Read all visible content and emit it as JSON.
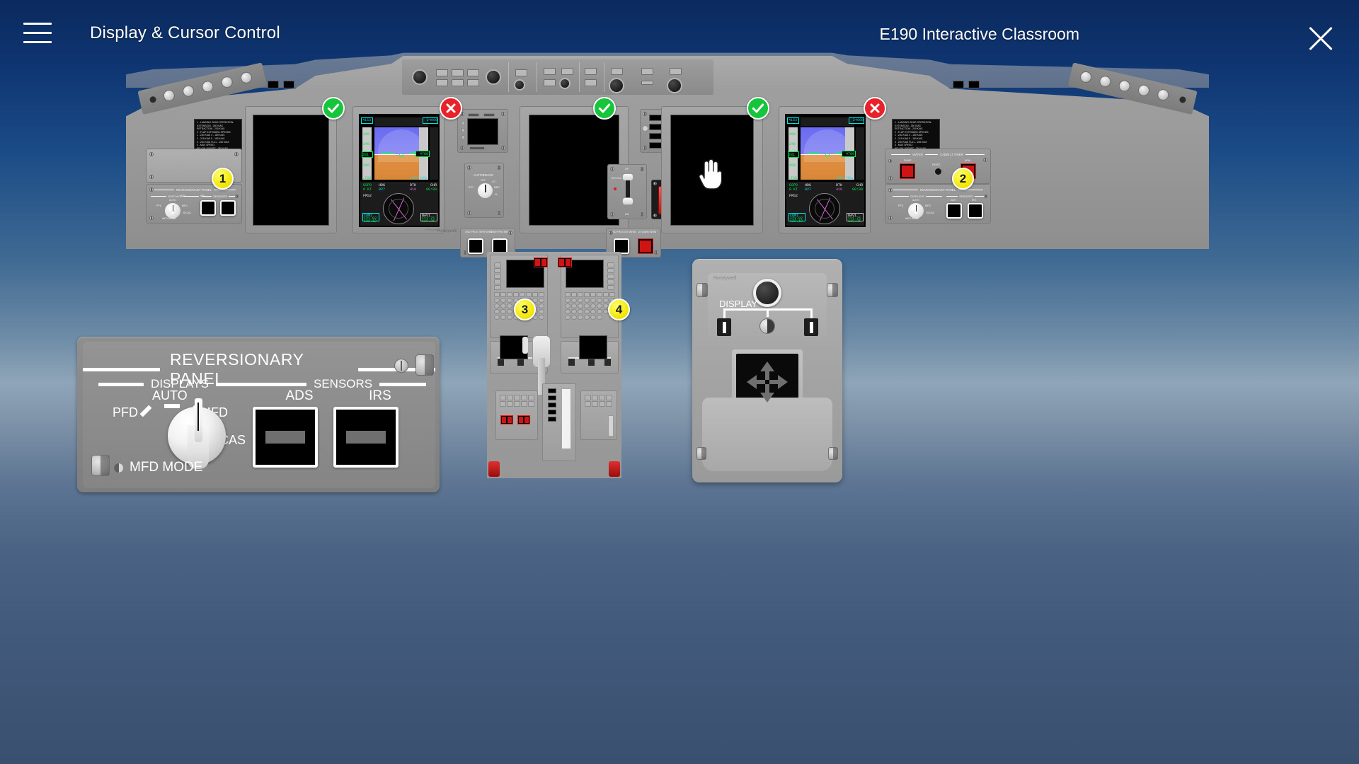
{
  "header": {
    "menu_icon": "hamburger-icon",
    "page_title": "Display & Cursor Control",
    "app_title": "E190 Interactive Classroom",
    "close_icon": "close-icon"
  },
  "hotspots": [
    {
      "id": "1",
      "label": "1",
      "name": "hotspot-1-captain-reversionary-panel"
    },
    {
      "id": "2",
      "label": "2",
      "name": "hotspot-2-first-officer-reversionary-panel"
    },
    {
      "id": "3",
      "label": "3",
      "name": "hotspot-3-pedestal-left"
    },
    {
      "id": "4",
      "label": "4",
      "name": "hotspot-4-cursor-control-device"
    }
  ],
  "status_marks": [
    {
      "state": "ok",
      "name": "status-mark-mfd-captain-outboard"
    },
    {
      "state": "bad",
      "name": "status-mark-pfd-captain"
    },
    {
      "state": "ok",
      "name": "status-mark-eicas-center"
    },
    {
      "state": "ok",
      "name": "status-mark-mfd-fo-inboard"
    },
    {
      "state": "bad",
      "name": "status-mark-pfd-fo"
    }
  ],
  "reversionary_panel": {
    "title": "REVERSIONARY PANEL",
    "displays_header": "DISPLAYS",
    "sensors_header": "SENSORS",
    "knob": {
      "selected": "AUTO",
      "positions": [
        "PFD",
        "AUTO",
        "MFD",
        "EICAS"
      ],
      "label_auto": "AUTO",
      "label_pfd": "PFD",
      "label_mfd": "MFD",
      "label_eicas": "EICAS"
    },
    "mfd_mode_label": "MFD MODE",
    "sensor_buttons": [
      {
        "label": "ADS",
        "name": "ads-reversion-button"
      },
      {
        "label": "IRS",
        "name": "irs-reversion-button"
      }
    ]
  },
  "cursor_control_device": {
    "brand": "Honeywell",
    "display_label": "DISPLAY",
    "knob_name": "ccd-rotary-knob",
    "touchpad_name": "ccd-touchpad"
  },
  "cockpit": {
    "brand": "Honeywell",
    "panels": {
      "water_cabin_lt_timer": {
        "left_title": "WATER",
        "right_title": "CABIN LT TIMER",
        "dump_label": "DUMP",
        "arm_label": "ARM",
        "reset_label": "RESET"
      },
      "autobrake": {
        "title": "AUTOBRAKE",
        "positions": [
          "OFF",
          "LO",
          "MED",
          "HI",
          "RTO"
        ]
      },
      "landing_gear": {
        "up_label": "UP",
        "down_label": "DN",
        "dn_lock_rel_label": "DN LOCK REL"
      },
      "gnd_prox": {
        "left_label": "GND PROX TERR INHIB",
        "right_label": "EMER PRK BRAKE",
        "gs_inhib_label": "GND PROX G/S INHIB",
        "lg_warn_label": "LG WARN INHIB"
      },
      "placard_lines": [
        "1 - LANDING GEAR OPERATION:",
        "    EXTENSION - 250 KIAS",
        "    RETRACTION - 200 KIAS",
        "2 - FLAP EXTENDED SPEEDS:",
        "    1 - 230 KIAS      4 - 180 KIAS",
        "    2 - 215 KIAS      5 - 180 KIAS",
        "    3 - 200 KIAS   FULL - 165 KIAS",
        "3 - MAX SPEED:",
        "    BELOW 10000FT - 250 KIAS"
      ]
    },
    "pfd": {
      "alt_box": "4153",
      "alt_right": "24000",
      "baro": "1013 hPa",
      "gspd_label": "GSPD",
      "gspd_value": "0 KT",
      "hdg_label": "HDG",
      "hdg_value": "027",
      "dtk_label": "DTK",
      "dtk_value": "410",
      "crt_label": "CHR",
      "crt_value": "00:00",
      "fms_label": "FMS2",
      "vor_label": "VOR",
      "com_label": "COM1",
      "com_freq_a": "121.82",
      "com_freq_b": "122.12",
      "nav_label": "NAV1",
      "nav_freq_a": "111.75",
      "nav_freq_b": "110.35"
    }
  },
  "colors": {
    "accent_yellow": "#f2e400",
    "ok_green": "#16c53c",
    "bad_red": "#e8222a",
    "panel_gray": "#8e8e8e",
    "sky_blue": "#0b2a5e"
  }
}
